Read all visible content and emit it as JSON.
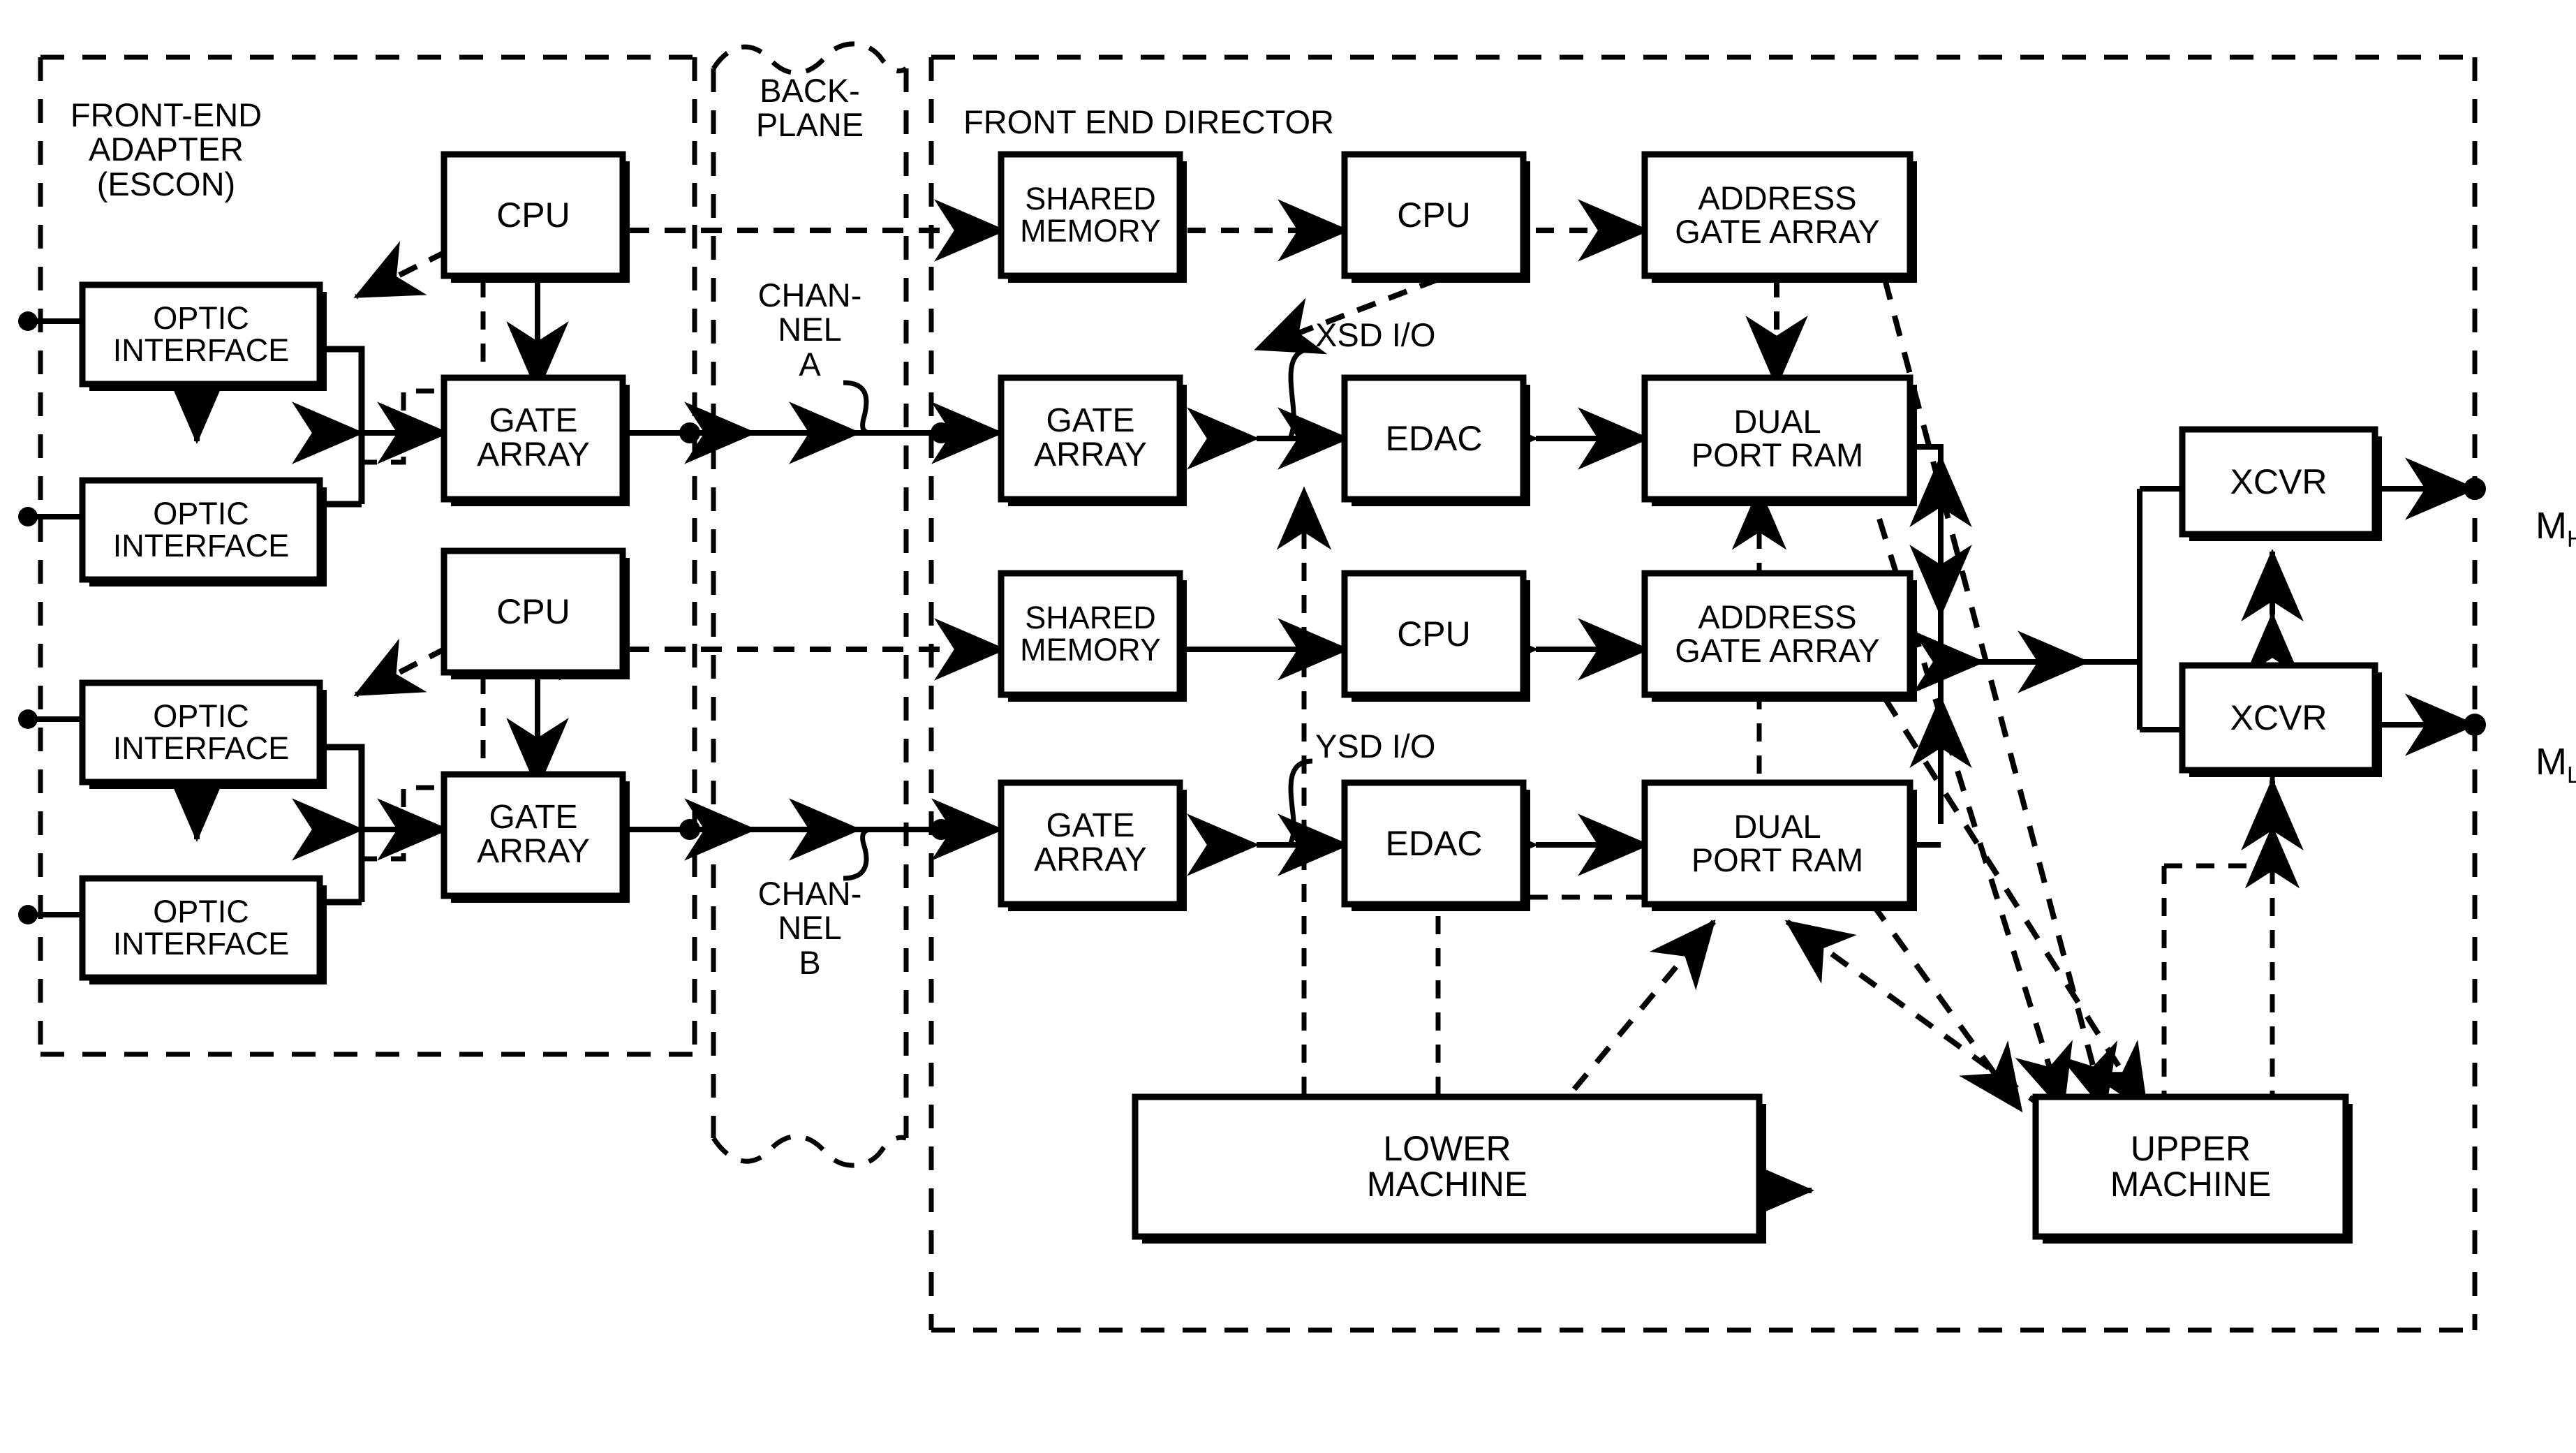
{
  "figure": {
    "type": "block-diagram",
    "title": "Front-End Adapter / Backplane / Front End Director block diagram"
  },
  "regions": {
    "front_end_adapter": {
      "label": "FRONT-END\nADAPTER\n(ESCON)"
    },
    "backplane": {
      "label": "BACK-\nPLANE"
    },
    "front_end_director": {
      "label": "FRONT END DIRECTOR"
    }
  },
  "channels": {
    "a": {
      "label": "CHAN-\nNEL\nA"
    },
    "b": {
      "label": "CHAN-\nNEL\nB"
    }
  },
  "bus_labels": {
    "xsd": "XSD I/O",
    "ysd": "YSD I/O"
  },
  "memory_ports": {
    "high": {
      "letter": "M",
      "subscript": "H"
    },
    "low": {
      "letter": "M",
      "subscript": "L"
    }
  },
  "adapter_blocks": [
    {
      "id": "cpu-a",
      "label": "CPU"
    },
    {
      "id": "gate-a",
      "label": "GATE\nARRAY"
    },
    {
      "id": "cpu-b",
      "label": "CPU"
    },
    {
      "id": "gate-b",
      "label": "GATE\nARRAY"
    },
    {
      "id": "optic-1",
      "label": "OPTIC\nINTERFACE"
    },
    {
      "id": "optic-2",
      "label": "OPTIC\nINTERFACE"
    },
    {
      "id": "optic-3",
      "label": "OPTIC\nINTERFACE"
    },
    {
      "id": "optic-4",
      "label": "OPTIC\nINTERFACE"
    }
  ],
  "director_blocks": [
    {
      "id": "shared-mem-1",
      "label": "SHARED\nMEMORY"
    },
    {
      "id": "cpu-1",
      "label": "CPU"
    },
    {
      "id": "addr-gate-1",
      "label": "ADDRESS\nGATE ARRAY"
    },
    {
      "id": "gate-array-1",
      "label": "GATE\nARRAY"
    },
    {
      "id": "edac-1",
      "label": "EDAC"
    },
    {
      "id": "dpram-1",
      "label": "DUAL\nPORT RAM"
    },
    {
      "id": "shared-mem-2",
      "label": "SHARED\nMEMORY"
    },
    {
      "id": "cpu-2",
      "label": "CPU"
    },
    {
      "id": "addr-gate-2",
      "label": "ADDRESS\nGATE ARRAY"
    },
    {
      "id": "gate-array-2",
      "label": "GATE\nARRAY"
    },
    {
      "id": "edac-2",
      "label": "EDAC"
    },
    {
      "id": "dpram-2",
      "label": "DUAL\nPORT RAM"
    },
    {
      "id": "lower-machine",
      "label": "LOWER\nMACHINE"
    },
    {
      "id": "upper-machine",
      "label": "UPPER\nMACHINE"
    }
  ],
  "transceivers": [
    {
      "id": "xcvr-h",
      "label": "XCVR"
    },
    {
      "id": "xcvr-l",
      "label": "XCVR"
    }
  ],
  "colors": {
    "ink": "#000000",
    "paper": "#ffffff"
  }
}
